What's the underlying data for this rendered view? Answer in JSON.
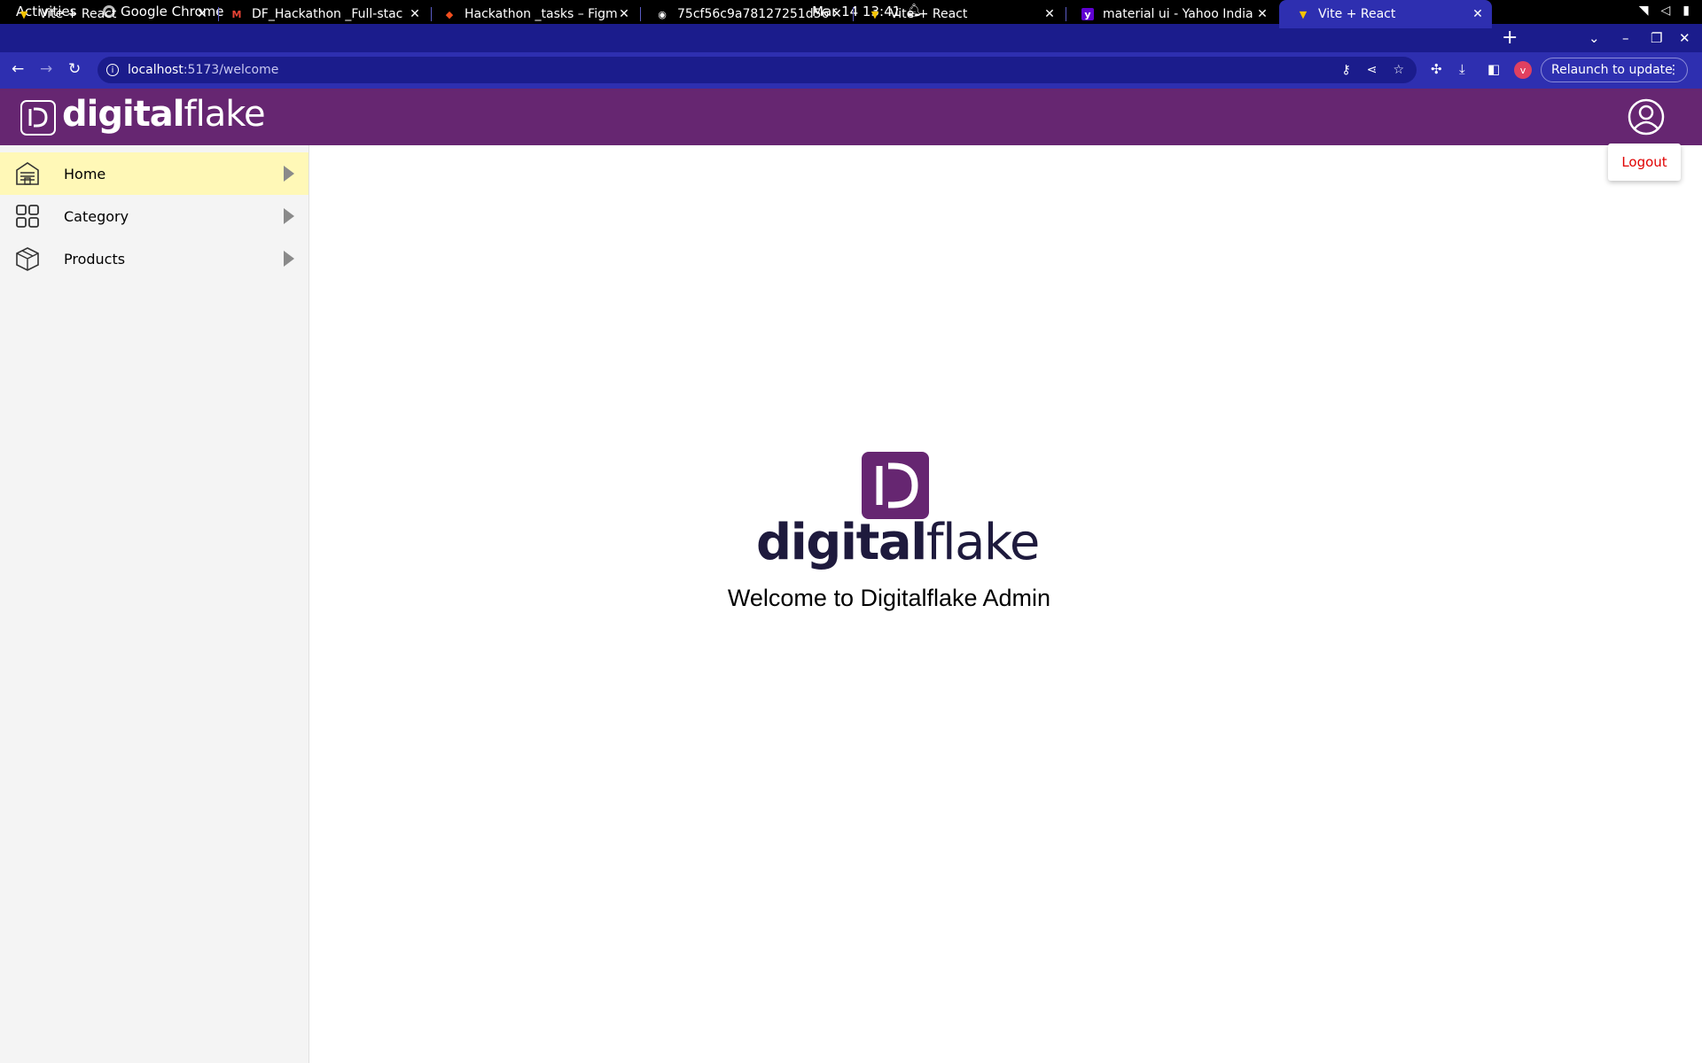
{
  "system_bar": {
    "activities": "Activities",
    "app_name": "Google Chrome",
    "clock": "Mar 14  13:41"
  },
  "browser": {
    "tabs": [
      {
        "title": "Vite + React",
        "favicon": "vite-icon"
      },
      {
        "title": "DF_Hackathon _Full-stac",
        "favicon": "gmail-icon"
      },
      {
        "title": "Hackathon _tasks – Figma",
        "favicon": "figma-icon"
      },
      {
        "title": "75cf56c9a78127251d562b",
        "favicon": "globe-icon"
      },
      {
        "title": "Vite + React",
        "favicon": "vite-icon"
      },
      {
        "title": "material ui - Yahoo India S",
        "favicon": "yahoo-icon"
      },
      {
        "title": "Vite + React",
        "favicon": "vite-icon",
        "active": true
      }
    ],
    "url_host": "localhost",
    "url_path": ":5173/welcome",
    "profile_initial": "v",
    "relaunch_label": "Relaunch to update"
  },
  "header": {
    "brand_bold": "digital",
    "brand_light": "flake",
    "accent_color": "#662671"
  },
  "user_menu": {
    "logout_label": "Logout",
    "logout_color": "#e00000"
  },
  "sidebar": {
    "items": [
      {
        "label": "Home",
        "icon": "home-building-icon",
        "active": true
      },
      {
        "label": "Category",
        "icon": "grid-icon",
        "active": false
      },
      {
        "label": "Products",
        "icon": "box-icon",
        "active": false
      }
    ],
    "active_bg": "#fff8b7"
  },
  "main": {
    "brand_bold": "digital",
    "brand_light": "flake",
    "welcome_text": "Welcome to Digitalflake Admin"
  }
}
